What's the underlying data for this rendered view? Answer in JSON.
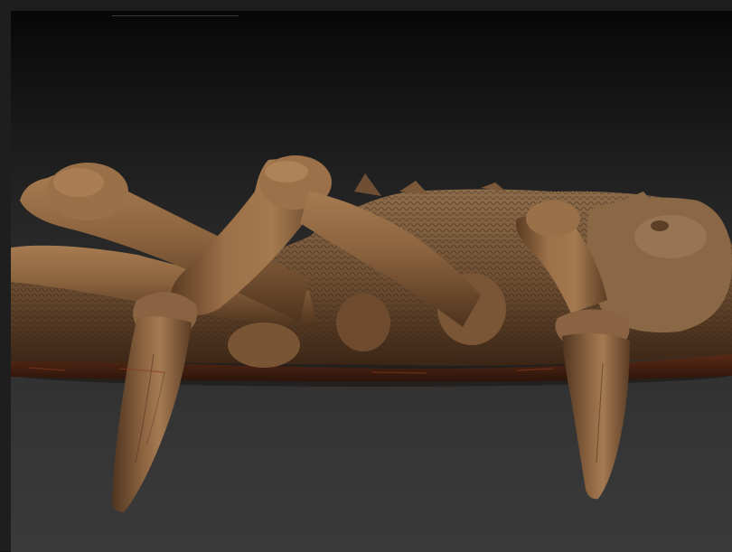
{
  "viewport": {
    "subject": "sculpt-render",
    "background_top": "#070707",
    "background_bottom": "#3a3a3a"
  },
  "colors": {
    "clay_light": "#a5794f",
    "clay_mid": "#86603c",
    "clay_dark": "#4a301c",
    "clay_shadow": "#2a190e",
    "belly_red": "#6b2e18"
  }
}
